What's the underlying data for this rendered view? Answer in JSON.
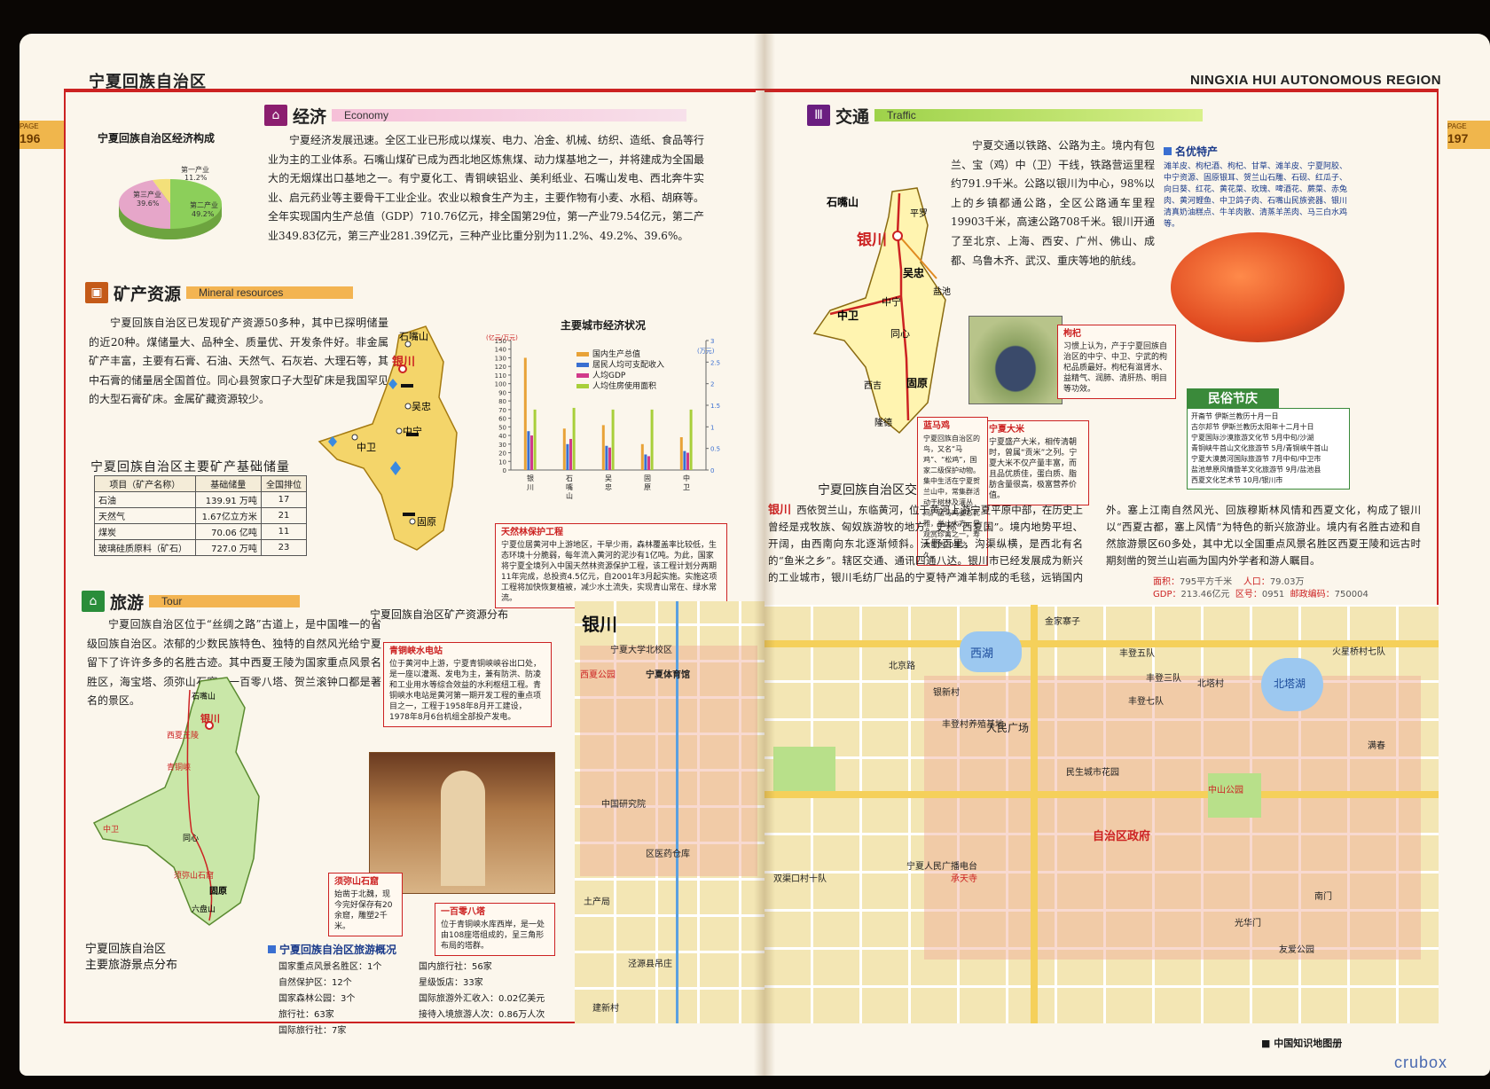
{
  "header": {
    "title_zh": "宁夏回族自治区",
    "title_en": "NINGXIA HUI AUTONOMOUS REGION",
    "page_label": "PAGE",
    "left_page_no": "196",
    "right_page_no": "197"
  },
  "economy": {
    "title_zh": "经济",
    "title_en": "Economy",
    "text": "宁夏经济发展迅速。全区工业已形成以煤炭、电力、冶金、机械、纺织、造纸、食品等行业为主的工业体系。石嘴山煤矿已成为西北地区炼焦煤、动力煤基地之一，并将建成为全国最大的无烟煤出口基地之一。有宁夏化工、青铜峡铝业、美利纸业、石嘴山发电、西北奔牛实业、启元药业等主要骨干工业企业。农业以粮食生产为主，主要作物有小麦、水稻、胡麻等。全年实现国内生产总值（GDP）710.76亿元，排全国第29位，第一产业79.54亿元，第二产业349.83亿元，第三产业281.39亿元，三种产业比重分别为11.2%、49.2%、39.6%。",
    "pie": {
      "title": "宁夏回族自治区经济构成",
      "slices": [
        {
          "label": "第一产业",
          "pct": "11.2%",
          "value": 11.2,
          "color": "#f3e07a"
        },
        {
          "label": "第二产业",
          "pct": "49.2%",
          "value": 49.2,
          "color": "#8ccf5a"
        },
        {
          "label": "第三产业",
          "pct": "39.6%",
          "value": 39.6,
          "color": "#e6a6c9"
        }
      ]
    }
  },
  "mineral": {
    "title_zh": "矿产资源",
    "title_en": "Mineral resources",
    "text": "宁夏回族自治区已发现矿产资源50多种，其中已探明储量的近20种。煤储量大、品种全、质量优、开发条件好。非金属矿产丰富，主要有石膏、石油、天然气、石灰岩、大理石等，其中石膏的储量居全国首位。同心县贺家口子大型矿床是我国罕见的大型石膏矿床。金属矿藏资源较少。",
    "table": {
      "title": "宁夏回族自治区主要矿产基础储量",
      "headers": [
        "项目（矿产名称）",
        "基础储量",
        "全国排位"
      ],
      "rows": [
        [
          "石油",
          "139.91 万吨",
          "17"
        ],
        [
          "天然气",
          "1.67亿立方米",
          "21"
        ],
        [
          "煤炭",
          "70.06 亿吨",
          "11"
        ],
        [
          "玻璃硅质原料（矿石）",
          "727.0 万吨",
          "23"
        ]
      ]
    },
    "map_caption": "宁夏回族自治区矿产资源分布",
    "map_places": [
      "石嘴山",
      "银川",
      "吴忠",
      "中宁",
      "中卫",
      "固原"
    ]
  },
  "chart_data": {
    "type": "bar",
    "title": "主要城市经济状况",
    "categories": [
      "银川",
      "石嘴山",
      "吴忠",
      "固原",
      "中卫"
    ],
    "y1_unit": "(亿元/万元)",
    "y2_unit": "(万元)",
    "ylim": [
      0,
      150
    ],
    "y2lim": [
      0,
      3
    ],
    "y_ticks": [
      "0",
      "10",
      "20",
      "30",
      "40",
      "50",
      "60",
      "70",
      "80",
      "90",
      "100",
      "110",
      "120",
      "130",
      "140",
      "150"
    ],
    "y2_ticks": [
      "0",
      "0.5",
      "1",
      "1.5",
      "2",
      "2.5",
      "3"
    ],
    "series": [
      {
        "name": "国内生产总值",
        "color": "#e8a237",
        "values": [
          130,
          48,
          52,
          30,
          38
        ]
      },
      {
        "name": "居民人均可支配收入",
        "color": "#3a6fd1",
        "values": [
          45,
          30,
          28,
          18,
          22
        ]
      },
      {
        "name": "人均GDP",
        "color": "#d13a8a",
        "values": [
          40,
          36,
          26,
          16,
          20
        ]
      },
      {
        "name": "人均住房使用面积",
        "color": "#a8cf3a",
        "values": [
          70,
          72,
          70,
          70,
          70
        ]
      }
    ]
  },
  "notes_left": {
    "forest": {
      "title": "天然林保护工程",
      "text": "宁夏位居黄河中上游地区，干旱少雨，森林覆盖率比较低，生态环境十分脆弱，每年流入黄河的泥沙有1亿吨。为此，国家将宁夏全境列入中国天然林资源保护工程，该工程计划分两期11年完成，总投资4.5亿元，自2001年3月起实施。实施这项工程将加快恢复植被，减少水土流失，实现青山常在、绿水常流。"
    },
    "dam": {
      "title": "青铜峡水电站",
      "text": "位于黄河中上游，宁夏青铜峡峡谷出口处，是一座以灌溉、发电为主，兼有防洪、防凌和工业用水等综合效益的水利枢纽工程。青铜峡水电站是黄河第一期开发工程的重点项目之一，工程于1958年8月开工建设，1978年8月6台机组全部投产发电。"
    },
    "grotto": {
      "title": "须弥山石窟",
      "text": "始凿于北魏，现今完好保存有20余窟，雕塑2千米。"
    },
    "pagoda": {
      "title": "一百零八塔",
      "text": "位于青铜峡水库西岸，是一处由108座塔组成的，呈三角形布局的塔群。"
    }
  },
  "tour": {
    "title_zh": "旅游",
    "title_en": "Tour",
    "text": "宁夏回族自治区位于“丝绸之路”古道上，是中国唯一的省级回族自治区。浓郁的少数民族特色、独特的自然风光给宁夏留下了许许多多的名胜古迹。其中西夏王陵为国家重点风景名胜区，海宝塔、须弥山石窟、一百零八塔、贺兰滚钟口都是著名的景区。",
    "map_caption_1": "宁夏回族自治区",
    "map_caption_2": "主要旅游景点分布",
    "overview_title": "宁夏回族自治区旅游概况",
    "overview": [
      {
        "k": "国家重点风景名胜区：",
        "v": "1个"
      },
      {
        "k": "自然保护区：",
        "v": "12个"
      },
      {
        "k": "国家森林公园：",
        "v": "3个"
      },
      {
        "k": "旅行社：",
        "v": "63家"
      },
      {
        "k": "国际旅行社：",
        "v": "7家"
      }
    ],
    "overview2": [
      {
        "k": "国内旅行社：",
        "v": "56家"
      },
      {
        "k": "星级饭店：",
        "v": "33家"
      },
      {
        "k": "国际旅游外汇收入：",
        "v": "0.02亿美元"
      },
      {
        "k": "接待入境旅游人次：",
        "v": "0.86万人次"
      }
    ],
    "map_places": [
      "石嘴山",
      "银川",
      "西夏王陵",
      "青铜峡",
      "中卫",
      "同心",
      "固原",
      "须弥山石窟",
      "六盘山"
    ]
  },
  "traffic": {
    "title_zh": "交通",
    "title_en": "Traffic",
    "text": "宁夏交通以铁路、公路为主。境内有包兰、宝（鸡）中（卫）干线，铁路营运里程约791.9千米。公路以银川为中心，98%以上的乡镇都通公路，全区公路通车里程19903千米，高速公路708千米。银川开通了至北京、上海、西安、广州、佛山、成都、乌鲁木齐、武汉、重庆等地的航线。",
    "map_caption": "宁夏回族自治区交通概况",
    "map_places": [
      "石嘴山",
      "银川",
      "吴忠",
      "中宁",
      "中卫",
      "同心",
      "固原",
      "盐池",
      "平罗",
      "西吉",
      "隆德"
    ]
  },
  "specialty": {
    "title": "名优特产",
    "text": "滩羊皮、枸杞酒、枸杞、甘草、滩羊皮、宁夏阿胶、中宁资源、固原银耳、贺兰山石雕、石砚、红瓜子、向日葵、红花、黄花菜、玫瑰、啤酒花、蕨菜、赤兔肉、黄河鲤鱼、中卫鸽子肉、石嘴山民族瓷器、银川清真奶油糕点、牛羊肉散、清蒸羊羔肉、马三白水鸡等。",
    "goji": {
      "title": "枸杞",
      "text": "习惯上认为，产于宁夏回族自治区的中宁、中卫、宁武的枸杞品质最好。枸杞有滋肾水、益精气、润肺、清肝热、明目等功效。"
    },
    "rice": {
      "title": "宁夏大米",
      "text": "宁夏盛产大米，相传清朝时，曾属“贡米”之列。宁夏大米不仅产量丰富，而且品优质佳，蛋白质、脂肪含量很高，极富营养价值。"
    },
    "bird": {
      "title": "蓝马鸡",
      "text": "宁夏回族自治区的鸟，又名“马鸡”、“松鸡”，国家二级保护动物。集中生活在宁夏贺兰山中，常集群活动于树林及灌丛间。蓝马鸡姿态优雅，举止大方，是观赏珍禽之一，寿命可达20年之久。"
    }
  },
  "festival": {
    "title": "民俗节庆",
    "items": [
      "开斋节  伊斯兰教历十月一日",
      "古尔邦节  伊斯兰教历太阳年十二月十日",
      "宁夏国际沙漠旅游文化节  5月中旬/沙湖",
      "青铜峡牛首山文化旅游节  5月/青铜峡牛首山",
      "宁夏大漠黄河国际旅游节  7月中旬/中卫市",
      "盐池草原风情暨羊文化旅游节  9月/盐池县",
      "西夏文化艺术节  10月/银川市"
    ]
  },
  "yinchuan": {
    "name": "银川",
    "text": "西依贺兰山，东临黄河，位于黄河上游宁夏平原中部，在历史上曾经是戎牧族、匈奴族游牧的地方。史称“西夏国”。境内地势平坦、开阔，由西南向东北逐渐倾斜。沃野百里，沟渠纵横，是西北有名的“鱼米之乡”。辖区交通、通讯四通八达。银川市已经发展成为新兴的工业城市，银川毛纺厂出品的宁夏特产滩羊制成的毛毯，远销国内外。塞上江南自然风光、回族穆斯林风情和西夏文化，构成了银川以“西夏古都，塞上风情”为特色的新兴旅游业。境内有名胜古迹和自然旅游景区60多处，其中尤以全国重点风景名胜区西夏王陵和远古时期刻凿的贺兰山岩画为国内外学者和游人瞩目。",
    "stats": [
      {
        "k": "面积：",
        "v": "795平方千米"
      },
      {
        "k": "人口：",
        "v": "79.03万"
      },
      {
        "k": "GDP：",
        "v": "213.46亿元"
      },
      {
        "k": "区号：",
        "v": "0951"
      },
      {
        "k": "邮政编码：",
        "v": "750004"
      }
    ],
    "map_labels": [
      "银川",
      "宁夏大学北校区",
      "宁夏体育馆",
      "西夏公园",
      "人民广场",
      "中山公园",
      "北塔湖",
      "金家寨子",
      "北京路",
      "丰登五队",
      "丰登三队",
      "丰登七队",
      "北塔村",
      "西湖",
      "银新村",
      "双渠口村十队",
      "中国研究院",
      "丰登村养殖基地",
      "民生城市花园",
      "自治区政府",
      "宁夏人民广播电台",
      "承天寺",
      "南门",
      "友爱公园",
      "光华门",
      "区医药仓库",
      "土产局",
      "泾源县吊庄",
      "建新村",
      "满春",
      "火星桥村七队"
    ]
  },
  "footer": {
    "series": "中国知识地图册",
    "watermark": "crubox"
  }
}
